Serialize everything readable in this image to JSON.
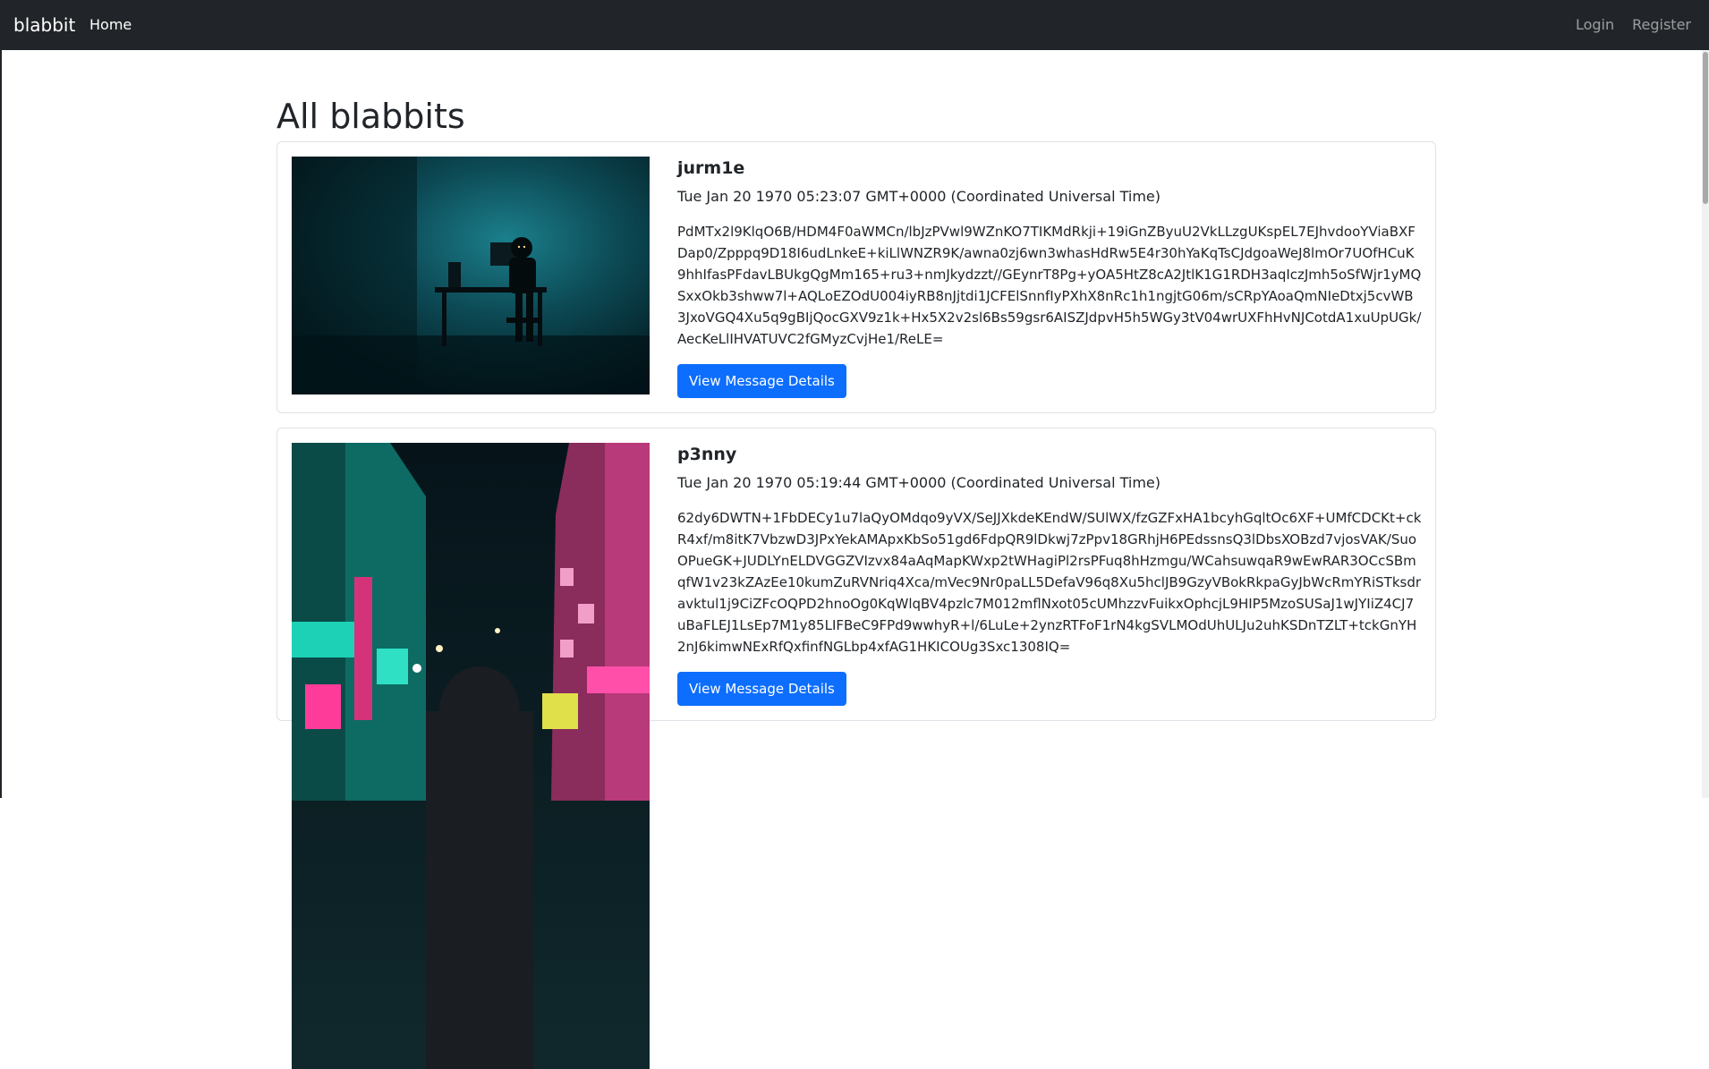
{
  "navbar": {
    "brand": "blabbit",
    "home": "Home",
    "login": "Login",
    "register": "Register"
  },
  "page": {
    "title": "All blabbits"
  },
  "posts": [
    {
      "author": "jurm1e",
      "date": "Tue Jan 20 1970 05:23:07 GMT+0000 (Coordinated Universal Time)",
      "content": "PdMTx2l9KlqO6B/HDM4F0aWMCn/lbJzPVwl9WZnKO7TIKMdRkji+19iGnZByuU2VkLLzgUKspEL7EJhvdooYViaBXFDap0/Zpppq9D18I6udLnkeE+kiLlWNZR9K/awna0zj6wn3whasHdRw5E4r30hYaKqTsCJdgoaWeJ8lmOr7UOfHCuK9hhIfasPFdavLBUkgQgMm165+ru3+nmJkydzzt//GEynrT8Pg+yOA5HtZ8cA2JtlK1G1RDH3aqIczJmh5oSfWjr1yMQSxxOkb3shww7l+AQLoEZOdU004iyRB8nJjtdi1JCFElSnnfIyPXhX8nRc1h1ngjtG06m/sCRpYAoaQmNIeDtxj5cvWB3JxoVGQ4Xu5q9gBIjQocGXV9z1k+Hx5X2v2sl6Bs59gsr6AISZJdpvH5h5WGy3tV04wrUXFhHvNJCotdA1xuUpUGk/AecKeLlIHVATUVC2fGMyzCvjHe1/ReLE=",
      "button": "View Message Details"
    },
    {
      "author": "p3nny",
      "date": "Tue Jan 20 1970 05:19:44 GMT+0000 (Coordinated Universal Time)",
      "content": "62dy6DWTN+1FbDECy1u7laQyOMdqo9yVX/SeJJXkdeKEndW/SUlWX/fzGZFxHA1bcyhGqltOc6XF+UMfCDCKt+ckR4xf/m8itK7VbzwD3JPxYekAMApxKbSo51gd6FdpQR9lDkwj7zPpv18GRhjH6PEdssnsQ3lDbsXOBzd7vjosVAK/SuoOPueGK+JUDLYnELDVGGZVIzvx84aAqMapKWxp2tWHagiPl2rsPFuq8hHzmgu/WCahsuwqaR9wEwRAR3OCcSBmqfW1v23kZAzEe10kumZuRVNriq4Xca/mVec9Nr0paLL5DefaV96q8Xu5hclJB9GzyVBokRkpaGyJbWcRmYRiSTksdravktul1j9CiZFcOQPD2hnoOg0KqWlqBV4pzlc7M012mflNxot05cUMhzzvFuikxOphcjL9HIP5MzoSUSaJ1wJYIiZ4CJ7uBaFLEJ1LsEp7M1y85LIFBeC9FPd9wwhyR+l/6LuLe+2ynzRTFoF1rN4kgSVLMOdUhULJu2uhKSDnTZLT+tckGnYH2nJ6kimwNExRfQxfinfNGLbp4xfAG1HKICOUg3Sxc1308IQ=",
      "button": "View Message Details"
    }
  ]
}
